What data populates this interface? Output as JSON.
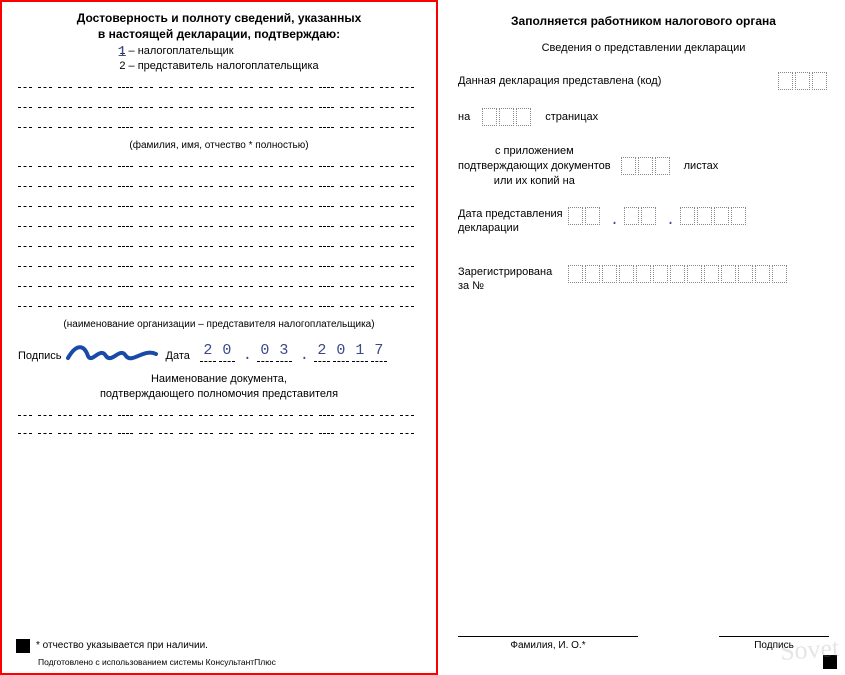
{
  "left": {
    "title_line1": "Достоверность и полноту сведений, указанных",
    "title_line2": "в настоящей декларации, подтверждаю:",
    "option1": "1 – налогоплательщик",
    "option2": "2 – представитель налогоплательщика",
    "filled_digit": "1",
    "fio_note": "(фамилия, имя, отчество * полностью)",
    "org_note": "(наименование организации – представителя налогоплательщика)",
    "sign_label": "Подпись",
    "date_label": "Дата",
    "date_d1": "2",
    "date_d2": "0",
    "date_m1": "0",
    "date_m2": "3",
    "date_y1": "2",
    "date_y2": "0",
    "date_y3": "1",
    "date_y4": "7",
    "date_dot": ".",
    "doc_name_l1": "Наименование документа,",
    "doc_name_l2": "подтверждающего полномочия представителя",
    "footnote": "* отчество указывается при наличии.",
    "credit": "Подготовлено с использованием системы КонсультантПлюс"
  },
  "right": {
    "title": "Заполняется работником налогового органа",
    "sub": "Сведения о представлении декларации",
    "declaration_presented": "Данная декларация представлена (код)",
    "na": "на",
    "pages": "страницах",
    "attach_l1": "с приложением",
    "attach_l2": "подтверждающих документов",
    "attach_l3": "или их копий на",
    "sheets": "листах",
    "date_present_l1": "Дата представления",
    "date_present_l2": "декларации",
    "registered_l1": "Зарегистрирована",
    "registered_l2": "за №",
    "fio_label": "Фамилия, И. О.*",
    "sign_label": "Подпись",
    "watermark": "Sovet"
  }
}
